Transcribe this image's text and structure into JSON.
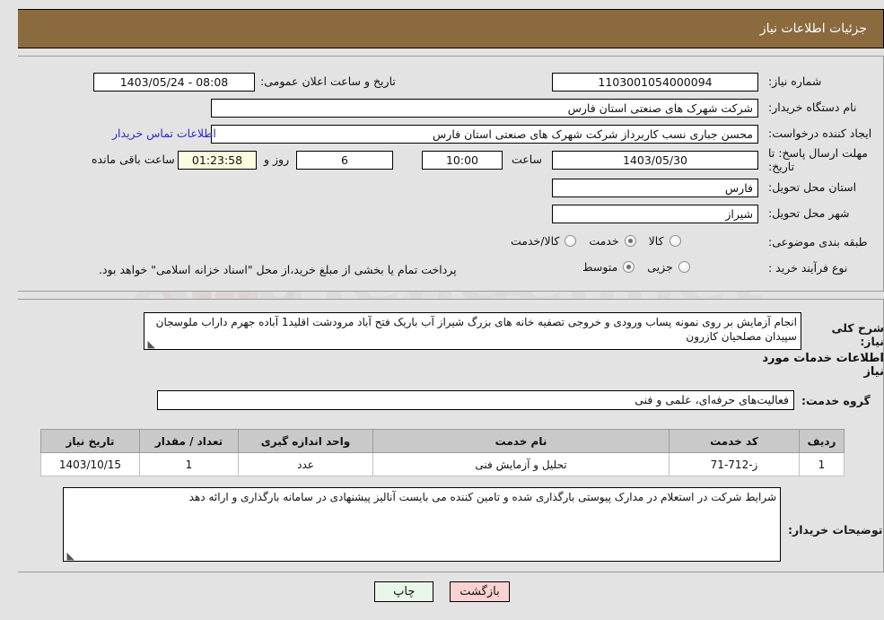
{
  "header": {
    "title": "جزئیات اطلاعات نیاز",
    "bg_color": "#8b6a3e",
    "text_color": "#ffffff"
  },
  "top_panel": {
    "need_number": {
      "label": "شماره نیاز:",
      "value": "1103001054000094"
    },
    "announce_datetime": {
      "label": "تاریخ و ساعت اعلان عمومی:",
      "value": "08:08 - 1403/05/24"
    },
    "buyer_org": {
      "label": "نام دستگاه خریدار:",
      "value": "شرکت شهرک های صنعتی استان فارس"
    },
    "creator": {
      "label": "ایجاد کننده درخواست:",
      "value": "محسن  جباری نسب کاربرداز شرکت شهرک های صنعتی استان فارس"
    },
    "contact_link": {
      "label": "اطلاعات تماس خریدار"
    },
    "deadline": {
      "label": "مهلت ارسال پاسخ: تا تاریخ:",
      "date": "1403/05/30",
      "hour_label": "ساعت",
      "hour": "10:00",
      "days": "6",
      "days_label": "روز و",
      "countdown": "01:23:58",
      "remaining_label": "ساعت باقی مانده"
    },
    "province": {
      "label": "استان محل تحویل:",
      "value": "فارس"
    },
    "city": {
      "label": "شهر محل تحویل:",
      "value": "شیراز"
    },
    "classification": {
      "label": "طبقه بندی موضوعی:",
      "options": [
        {
          "label": "کالا",
          "selected": false
        },
        {
          "label": "خدمت",
          "selected": true
        },
        {
          "label": "کالا/خدمت",
          "selected": false
        }
      ]
    },
    "purchase_type": {
      "label": "نوع فرآیند خرید :",
      "options": [
        {
          "label": "جزیی",
          "selected": false
        },
        {
          "label": "متوسط",
          "selected": true
        }
      ],
      "note": "پرداخت تمام یا بخشی از مبلغ خرید،از محل \"اسناد خزانه اسلامی\" خواهد بود."
    }
  },
  "bottom_panel": {
    "need_desc": {
      "label": "شرح کلی نیاز:",
      "value": "انجام آزمایش بر روی نمونه پساب ورودی و خروجی تصفیه خانه های بزرگ شیراز آب باریک فتح آباد مرودشت اقلید1 آباده جهرم داراب ملوسجان سپیدان مصلحیان کازرون"
    },
    "services_heading": "اطلاعات خدمات مورد نیاز",
    "service_group": {
      "label": "گروه خدمت:",
      "value": "فعالیت‌های حرفه‌ای، علمی و فنی"
    },
    "table": {
      "columns": [
        "ردیف",
        "کد خدمت",
        "نام خدمت",
        "واحد اندازه گیری",
        "تعداد / مقدار",
        "تاریخ نیاز"
      ],
      "rows": [
        {
          "radif": "1",
          "code": "ز-712-71",
          "name": "تحلیل و آزمایش فنی",
          "unit": "عدد",
          "qty": "1",
          "need_date": "1403/10/15"
        }
      ]
    },
    "buyer_notes": {
      "label": "توضیحات خریدار:",
      "value": "شرایط شرکت در استعلام در مدارک پیوستی بارگذاری شده و تامین کننده می بایست آنالیز پیشنهادی در سامانه بارگذاری و ارائه دهد"
    }
  },
  "footer": {
    "print_button": "چاپ",
    "back_button": "بازگشت"
  },
  "watermark": {
    "text": "AriaTender.net"
  }
}
